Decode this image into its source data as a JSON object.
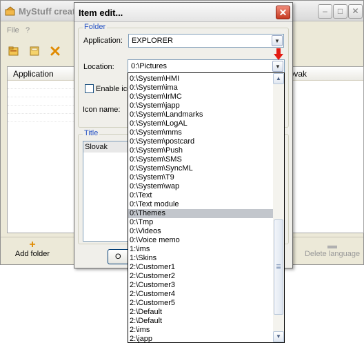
{
  "main_window": {
    "title": "MyStuff creat",
    "menu": {
      "file": "File",
      "help": "?"
    },
    "table_header": "Application",
    "right_table_header": "lovak",
    "add_folder": "Add folder",
    "delete_language": "Delete language",
    "window_buttons": {
      "minimize": "–",
      "maximize": "□",
      "close": "✕"
    }
  },
  "dialog": {
    "title": "Item edit...",
    "close_glyph": "✕",
    "folder_group": "Folder",
    "application_label": "Application:",
    "application_value": "EXPLORER",
    "location_label": "Location:",
    "location_value": "0:\\Pictures",
    "enable_icon_label": "Enable ico",
    "icon_name_label": "Icon name:",
    "title_group": "Title",
    "title_rows": [
      "Slovak"
    ],
    "ok_label": "O"
  },
  "dropdown": {
    "items": [
      "0:\\System\\HMI",
      "0:\\System\\ima",
      "0:\\System\\IrMC",
      "0:\\System\\japp",
      "0:\\System\\Landmarks",
      "0:\\System\\LogAL",
      "0:\\System\\mms",
      "0:\\System\\postcard",
      "0:\\System\\Push",
      "0:\\System\\SMS",
      "0:\\System\\SyncML",
      "0:\\System\\T9",
      "0:\\System\\wap",
      "0:\\Text",
      "0:\\Text module",
      "0:\\Themes",
      "0:\\Tmp",
      "0:\\Videos",
      "0:\\Voice memo",
      "1:\\ims",
      "1:\\Skins",
      "2:\\Customer1",
      "2:\\Customer2",
      "2:\\Customer3",
      "2:\\Customer4",
      "2:\\Customer5",
      "2:\\Default",
      "2:\\Default",
      "2:\\ims",
      "2:\\japp"
    ],
    "selected_index": 15,
    "scroll_up": "▲",
    "scroll_down": "▼"
  },
  "icons": {
    "dropdown_arrow": "▼",
    "indicator": "red-down-arrow-icon",
    "add": "+",
    "remove": "▬"
  },
  "colors": {
    "indicator_red": "#e31b12",
    "selected_row": "#c2c6cc",
    "legend_blue": "#2a56c6"
  }
}
